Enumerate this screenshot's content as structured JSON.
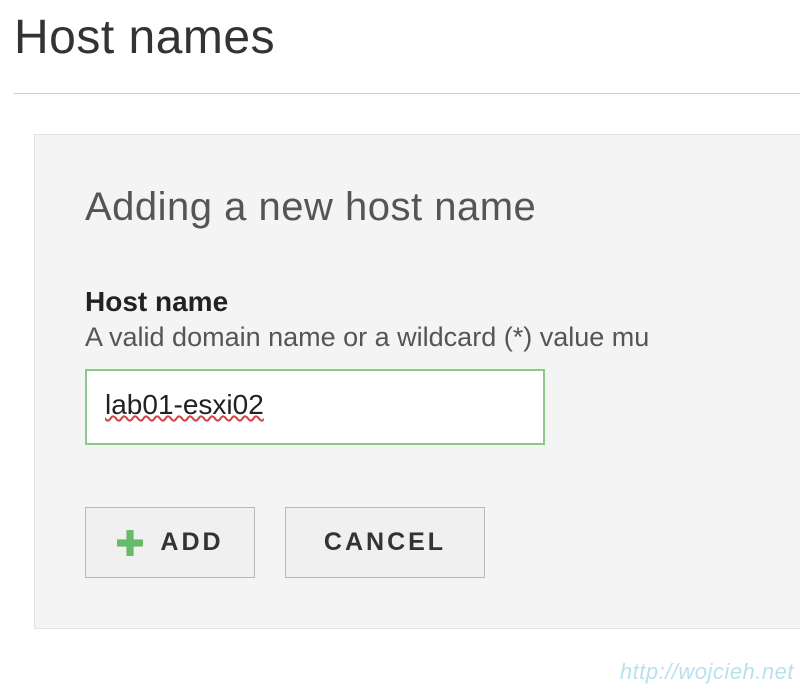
{
  "page": {
    "title": "Host names"
  },
  "panel": {
    "title": "Adding a new host name",
    "field_label": "Host name",
    "field_help": "A valid domain name or a wildcard (*) value mu",
    "input_value": "lab01-esxi02"
  },
  "buttons": {
    "add_label": "ADD",
    "cancel_label": "CANCEL"
  },
  "watermark": "http://wojcieh.net"
}
